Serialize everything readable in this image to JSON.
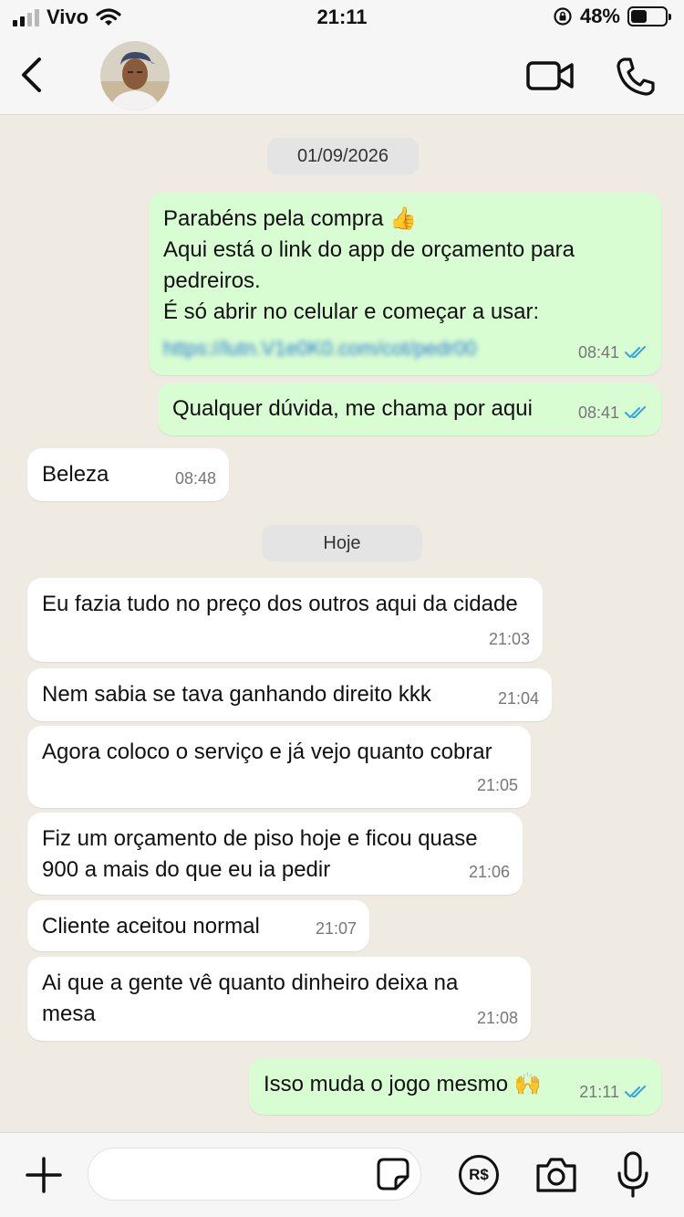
{
  "status_bar": {
    "carrier": "Vivo",
    "time": "21:11",
    "battery_percent": "48%",
    "battery_level": 0.48
  },
  "header": {
    "back_icon": "chevron-left-icon",
    "avatar_icon": "contact-avatar",
    "video_icon": "video-camera-icon",
    "call_icon": "phone-icon"
  },
  "chat": {
    "date_pills": [
      "01/09/2026",
      "Hoje"
    ],
    "messages": [
      {
        "direction": "out",
        "text": "Parabéns pela compra 👍\nAqui está o link do app de orçamento para pedreiros.\nÉ só abrir no celular e começar a usar:",
        "link": "https://lutn.V1e0K0.com/cot/pedr00",
        "time": "08:41",
        "read": true
      },
      {
        "direction": "out",
        "text": "Qualquer dúvida, me chama por aqui",
        "time": "08:41",
        "read": true
      },
      {
        "direction": "in",
        "text": "Beleza",
        "time": "08:48"
      },
      {
        "direction": "in",
        "text": "Eu fazia tudo no preço dos outros aqui da cidade",
        "time": "21:03"
      },
      {
        "direction": "in",
        "text": "Nem sabia se tava ganhando direito kkk",
        "time": "21:04"
      },
      {
        "direction": "in",
        "text": "Agora coloco o serviço e já vejo quanto cobrar",
        "time": "21:05"
      },
      {
        "direction": "in",
        "text": "Fiz um orçamento de piso hoje e ficou quase 900 a mais do que eu ia pedir",
        "time": "21:06"
      },
      {
        "direction": "in",
        "text": "Cliente aceitou normal",
        "time": "21:07"
      },
      {
        "direction": "in",
        "text": "Ai que a gente vê quanto dinheiro deixa na mesa",
        "time": "21:08"
      },
      {
        "direction": "out",
        "text": "Isso muda o jogo mesmo 🙌",
        "time": "21:11",
        "read": true
      }
    ]
  },
  "input_bar": {
    "plus_icon": "plus-icon",
    "message_value": "",
    "sticker_icon": "sticker-icon",
    "pay_label": "R$",
    "camera_icon": "camera-icon",
    "mic_icon": "microphone-icon"
  },
  "colors": {
    "chat_background": "#efeae2",
    "outgoing_bubble": "#d9fdd3",
    "incoming_bubble": "#ffffff",
    "read_ticks": "#34a3e8"
  }
}
